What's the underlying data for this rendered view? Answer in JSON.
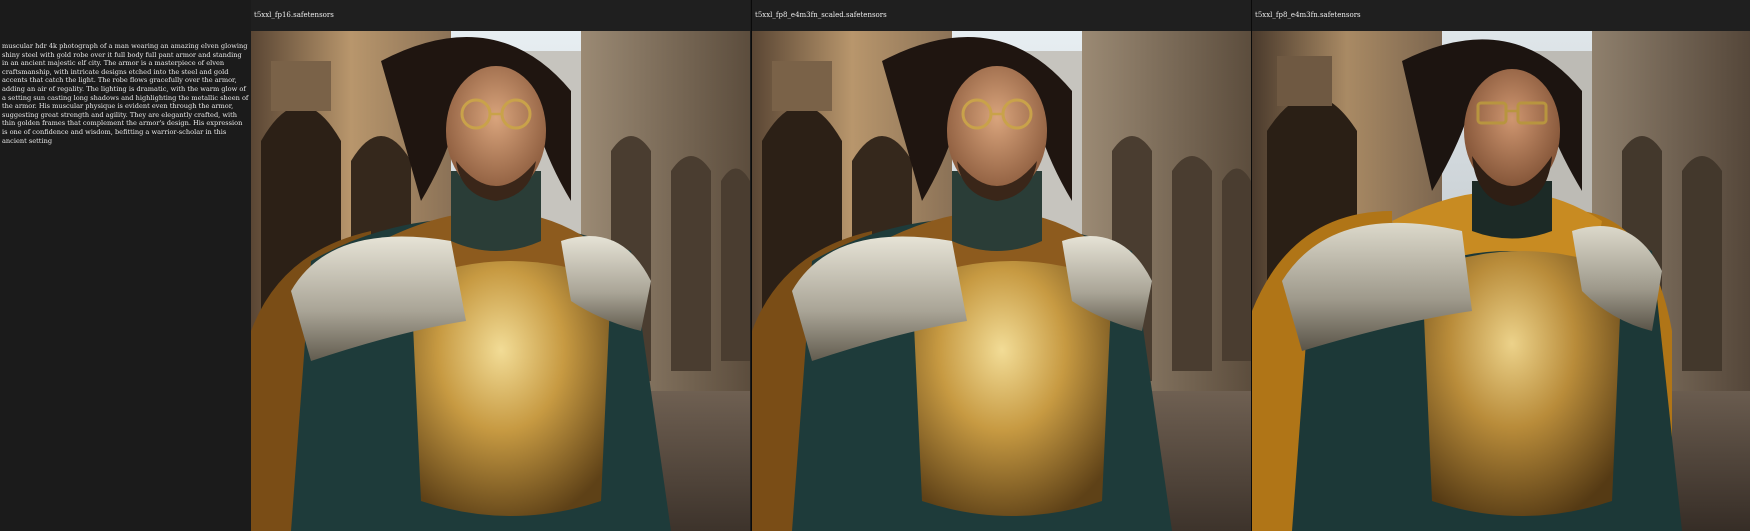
{
  "prompt": {
    "text": "muscular hdr 4k photograph of a man wearing an amazing elven glowing shiny steel with gold robe over it full body full pant armor and standing in an ancient majestic elf city. The armor is a masterpiece of elven craftsmanship, with intricate designs etched into the steel and gold accents that catch the light. The robe flows gracefully over the armor, adding an air of regality. The lighting is dramatic, with the warm glow of a setting sun casting long shadows and highlighting the metallic sheen of the armor. His muscular physique is evident even through the armor, suggesting great strength and agility. They are elegantly crafted, with thin golden frames that complement the armor's design. His expression is one of confidence and wisdom, befitting a warrior-scholar in this ancient setting"
  },
  "columns": [
    {
      "title": "t5xxl_fp16.safetensors",
      "image": "warrior-portrait"
    },
    {
      "title": "t5xxl_fp8_e4m3fn_scaled.safetensors",
      "image": "warrior-portrait"
    },
    {
      "title": "t5xxl_fp8_e4m3fn.safetensors",
      "image": "warrior-portrait"
    }
  ],
  "colors": {
    "background": "#1b1b1b",
    "header": "#1f1f1f",
    "text": "#e8e8e8",
    "armor_gold": "#c9a24a",
    "armor_steel": "#b9b9b2",
    "tunic": "#1e3b3a",
    "cloak": "#a86e1c",
    "stone": "#7d6c57"
  }
}
